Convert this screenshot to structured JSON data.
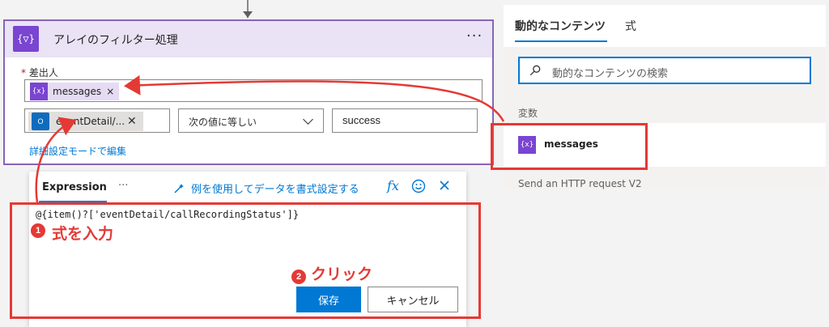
{
  "card": {
    "icon": "{▽}",
    "title": "アレイのフィルター処理",
    "more": "···",
    "from_label": "差出人",
    "required_mark": "*",
    "from_token": {
      "icon": "{x}",
      "label": "messages",
      "remove": "×"
    },
    "condition": {
      "left_token": {
        "icon": "O",
        "label": "eventDetail/...",
        "remove": "✕"
      },
      "operator": "次の値に等しい",
      "value": "success"
    },
    "advanced_link": "詳細設定モードで編集"
  },
  "dynamic_panel": {
    "tabs": [
      "動的なコンテンツ",
      "式"
    ],
    "search_placeholder": "動的なコンテンツの検索",
    "section_label": "変数",
    "item": {
      "icon": "{x}",
      "label": "messages"
    },
    "next_section": "Send an HTTP request V2"
  },
  "expression": {
    "tab": "Expression",
    "more": "···",
    "example_link": "例を使用してデータを書式設定する",
    "fx_label": "fx",
    "code": "@{item()?['eventDetail/callRecordingStatus']}",
    "save_label": "保存",
    "cancel_label": "キャンセル"
  },
  "annotations": {
    "step1_num": "1",
    "step1_text": "式を入力",
    "step2_num": "2",
    "step2_text": "クリック",
    "color": "#e53935"
  }
}
